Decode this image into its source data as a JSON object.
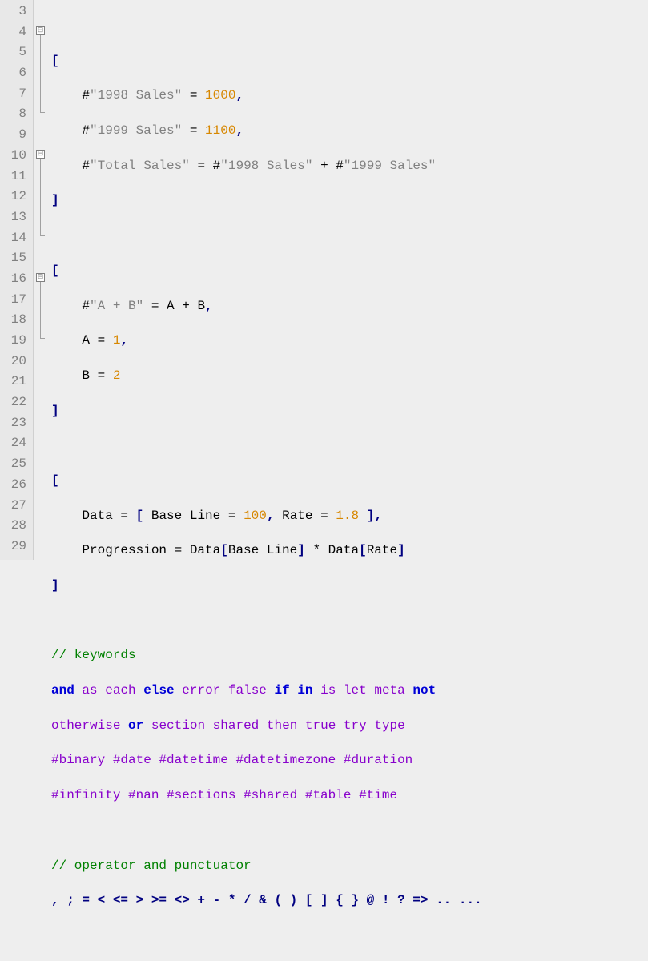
{
  "lines": {
    "3": "3",
    "4": "4",
    "5": "5",
    "6": "6",
    "7": "7",
    "8": "8",
    "9": "9",
    "10": "10",
    "11": "11",
    "12": "12",
    "13": "13",
    "14": "14",
    "15": "15",
    "16": "16",
    "17": "17",
    "18": "18",
    "19": "19",
    "20": "20",
    "21": "21",
    "22": "22",
    "23": "23",
    "24": "24",
    "25": "25",
    "26": "26",
    "27": "27",
    "28": "28",
    "29": "29"
  },
  "fold": {
    "minus": "⊟"
  },
  "code": {
    "l4": {
      "bracket": "["
    },
    "l5": {
      "hash": "#",
      "str": "\"1998 Sales\"",
      "eq": " = ",
      "num": "1000",
      "comma": ","
    },
    "l6": {
      "hash": "#",
      "str": "\"1999 Sales\"",
      "eq": " = ",
      "num": "1100",
      "comma": ","
    },
    "l7": {
      "hash1": "#",
      "str1": "\"Total Sales\"",
      "eq": " = ",
      "hash2": "#",
      "str2": "\"1998 Sales\"",
      "plus": " + ",
      "hash3": "#",
      "str3": "\"1999 Sales\""
    },
    "l8": {
      "bracket": "]"
    },
    "l10": {
      "bracket": "["
    },
    "l11": {
      "hash": "#",
      "str": "\"A + B\"",
      "eq": " = A + B",
      "comma": ","
    },
    "l12": {
      "a": "A = ",
      "num": "1",
      "comma": ","
    },
    "l13": {
      "b": "B = ",
      "num": "2"
    },
    "l14": {
      "bracket": "]"
    },
    "l16": {
      "bracket": "["
    },
    "l17": {
      "t1": "Data = ",
      "b1": "[",
      "t2": " Base Line = ",
      "n1": "100",
      "c1": ",",
      "t3": " Rate = ",
      "n2": "1.8",
      "sp": " ",
      "b2": "]",
      "c2": ","
    },
    "l18": {
      "t1": "Progression = Data",
      "b1": "[",
      "t2": "Base Line",
      "b2": "]",
      "t3": " * Data",
      "b3": "[",
      "t4": "Rate",
      "b4": "]"
    },
    "l19": {
      "bracket": "]"
    },
    "l21": {
      "comment": "// keywords"
    },
    "l22": {
      "and": "and",
      "s1": " ",
      "as": "as",
      "s2": " ",
      "each": "each",
      "s3": " ",
      "else": "else",
      "s4": " ",
      "error": "error",
      "s5": " ",
      "false": "false",
      "s6": " ",
      "if": "if",
      "s7": " ",
      "in": "in",
      "s8": " ",
      "is": "is",
      "s9": " ",
      "let": "let",
      "s10": " ",
      "meta": "meta",
      "s11": " ",
      "not": "not"
    },
    "l23": {
      "otherwise": "otherwise",
      "s1": " ",
      "or": "or",
      "s2": " ",
      "section": "section",
      "s3": " ",
      "shared": "shared",
      "s4": " ",
      "then": "then",
      "s5": " ",
      "true": "true",
      "s6": " ",
      "try": "try",
      "s7": " ",
      "type": "type"
    },
    "l24": {
      "t": "#binary #date #datetime #datetimezone #duration"
    },
    "l25": {
      "t": "#infinity #nan #sections #shared #table #time"
    },
    "l27": {
      "comment": "// operator and punctuator"
    },
    "l28": {
      "ops": ", ; = < <= > >= <> + - * / & ( ) [ ] { } @ ! ? => .. ..."
    }
  }
}
